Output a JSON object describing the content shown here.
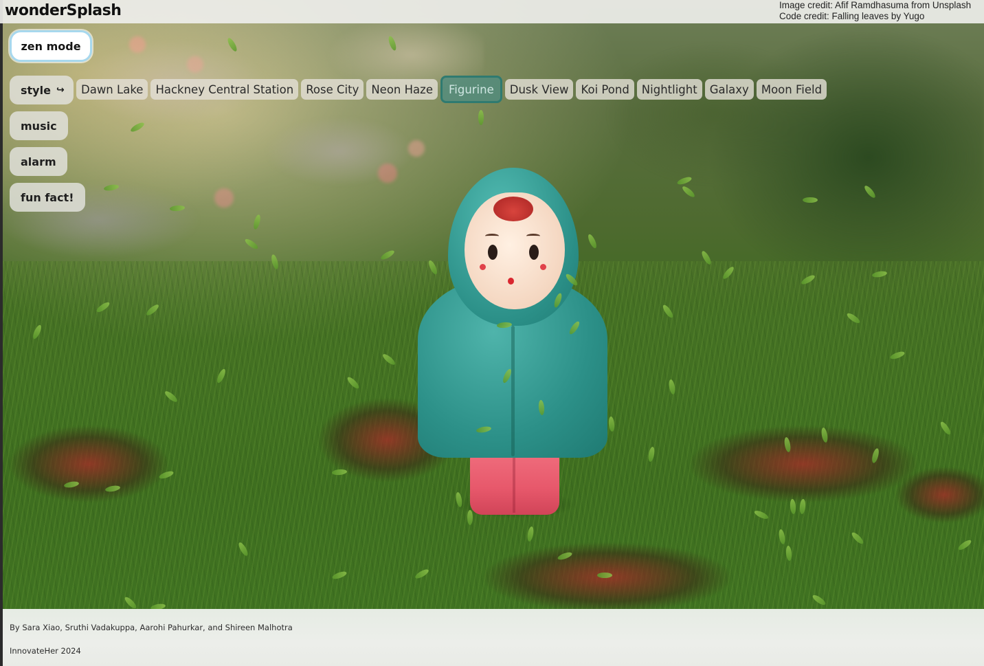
{
  "brand": "wonderSplash",
  "credits": {
    "image": "Image credit: Afif Ramdhasuma from Unsplash",
    "code": "Code credit: Falling leaves by Yugo"
  },
  "controls": {
    "zen_label": "zen mode",
    "style_label": "style",
    "style_arrow_icon": "↪",
    "music_label": "music",
    "alarm_label": "alarm",
    "fun_fact_label": "fun fact!"
  },
  "styles": [
    {
      "label": "Dawn Lake",
      "selected": false
    },
    {
      "label": "Hackney Central Station",
      "selected": false
    },
    {
      "label": "Rose City",
      "selected": false
    },
    {
      "label": "Neon Haze",
      "selected": false
    },
    {
      "label": "Figurine",
      "selected": true
    },
    {
      "label": "Dusk View",
      "selected": false
    },
    {
      "label": "Koi Pond",
      "selected": false
    },
    {
      "label": "Nightlight",
      "selected": false
    },
    {
      "label": "Galaxy",
      "selected": false
    },
    {
      "label": "Moon Field",
      "selected": false
    }
  ],
  "footer": {
    "authors": "By Sara Xiao, Sruthi Vadakuppa, Aarohi Pahurkar, and Shireen Malhotra",
    "event": "InnovateHer 2024"
  },
  "colors": {
    "selected_chip_border": "#2f7a70",
    "zen_border": "#a7d8ee",
    "leaf": "#7bb03c"
  }
}
